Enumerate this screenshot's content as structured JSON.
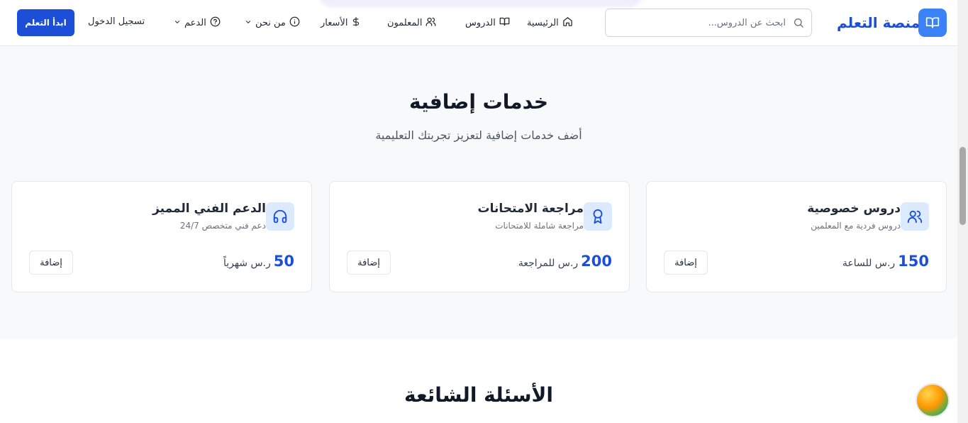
{
  "header": {
    "logo_text": "منصة التعلم",
    "search_placeholder": "ابحث عن الدروس...",
    "nav": [
      {
        "label": "الرئيسية",
        "icon": "home-icon"
      },
      {
        "label": "الدروس",
        "icon": "book-icon"
      },
      {
        "label": "المعلمون",
        "icon": "users-icon"
      },
      {
        "label": "الأسعار",
        "icon": "dollar-icon"
      },
      {
        "label": "من نحن",
        "icon": "info-icon"
      },
      {
        "label": "الدعم",
        "icon": "help-icon"
      }
    ],
    "login_label": "تسجيل الدخول",
    "start_label": "ابدأ التعلم"
  },
  "services": {
    "title": "خدمات إضافية",
    "subtitle": "أضف خدمات إضافية لتعزيز تجربتك التعليمية",
    "cards": [
      {
        "title": "دروس خصوصية",
        "desc": "دروس فردية مع المعلمين",
        "price": "150",
        "unit": "ر.س للساعة",
        "button": "إضافة",
        "icon": "users-icon"
      },
      {
        "title": "مراجعة الامتحانات",
        "desc": "مراجعة شاملة للامتحانات",
        "price": "200",
        "unit": "ر.س للمراجعة",
        "button": "إضافة",
        "icon": "award-icon"
      },
      {
        "title": "الدعم الفني المميز",
        "desc": "دعم فني متخصص 24/7",
        "price": "50",
        "unit": "ر.س شهرياً",
        "button": "إضافة",
        "icon": "headphones-icon"
      }
    ]
  },
  "faq": {
    "title": "الأسئلة الشائعة"
  },
  "colors": {
    "primary": "#1d4ed8",
    "accent": "#3b82f6",
    "section_bg": "#f8f9fa",
    "icon_bg": "#dbeafe"
  }
}
